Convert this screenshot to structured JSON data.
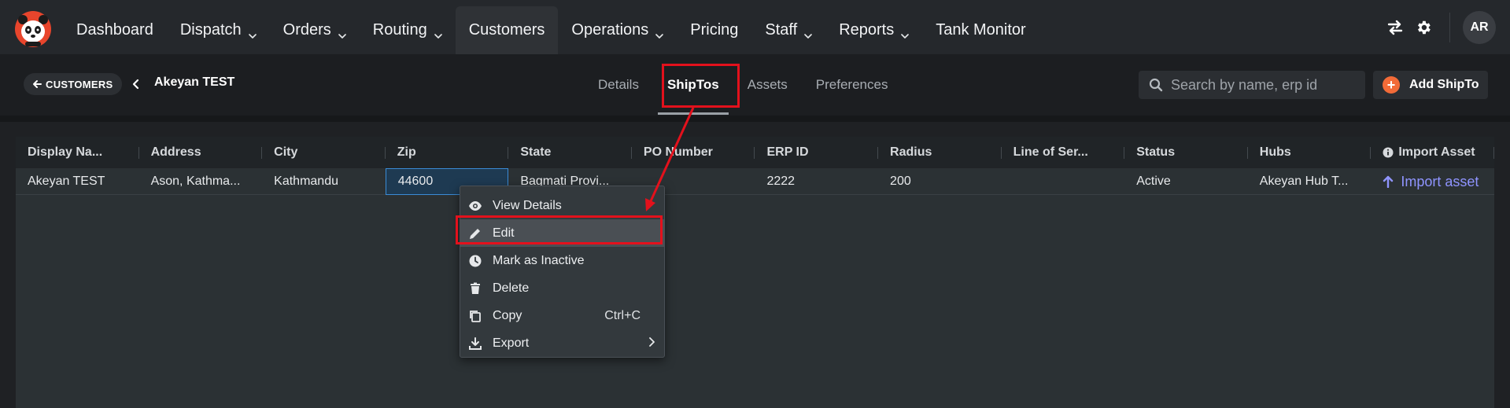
{
  "nav": {
    "items": [
      {
        "label": "Dashboard",
        "dropdown": false
      },
      {
        "label": "Dispatch",
        "dropdown": true
      },
      {
        "label": "Orders",
        "dropdown": true
      },
      {
        "label": "Routing",
        "dropdown": true
      },
      {
        "label": "Customers",
        "dropdown": false,
        "active": true
      },
      {
        "label": "Operations",
        "dropdown": true
      },
      {
        "label": "Pricing",
        "dropdown": false
      },
      {
        "label": "Staff",
        "dropdown": true
      },
      {
        "label": "Reports",
        "dropdown": true
      },
      {
        "label": "Tank Monitor",
        "dropdown": false
      }
    ],
    "avatar_initials": "AR",
    "icons": [
      "swap-icon",
      "gear-icon"
    ]
  },
  "subbar": {
    "back_label": "CUSTOMERS",
    "title": "Akeyan TEST",
    "tabs": [
      {
        "label": "Details",
        "active": false
      },
      {
        "label": "ShipTos",
        "active": true
      },
      {
        "label": "Assets",
        "active": false
      },
      {
        "label": "Preferences",
        "active": false
      }
    ],
    "search_placeholder": "Search by name, erp id",
    "add_label": "Add ShipTo"
  },
  "table": {
    "columns": [
      "Display Na...",
      "Address",
      "City",
      "Zip",
      "State",
      "PO Number",
      "ERP ID",
      "Radius",
      "Line of Ser...",
      "Status",
      "Hubs",
      "Import Asset"
    ],
    "rows": [
      {
        "cells": [
          "Akeyan TEST",
          "Ason, Kathma...",
          "Kathmandu",
          "44600",
          "Bagmati Provi...",
          "",
          "2222",
          "200",
          "",
          "Active",
          "Akeyan Hub T...",
          "Import asset"
        ]
      }
    ]
  },
  "context_menu": {
    "items": [
      {
        "label": "View Details",
        "icon": "eye-icon",
        "shortcut": ""
      },
      {
        "label": "Edit",
        "icon": "pencil-icon",
        "shortcut": "",
        "highlighted": true
      },
      {
        "label": "Mark as Inactive",
        "icon": "clock-icon",
        "shortcut": ""
      },
      {
        "label": "Delete",
        "icon": "trash-icon",
        "shortcut": ""
      },
      {
        "label": "Copy",
        "icon": "copy-icon",
        "shortcut": "Ctrl+C"
      },
      {
        "label": "Export",
        "icon": "download-icon",
        "shortcut": "",
        "submenu": true
      }
    ]
  },
  "colors": {
    "accent_orange": "#f26b38",
    "annotation_red": "#e3111c",
    "link_blue": "#8f94ff",
    "selection_blue": "#3a8bd6"
  }
}
